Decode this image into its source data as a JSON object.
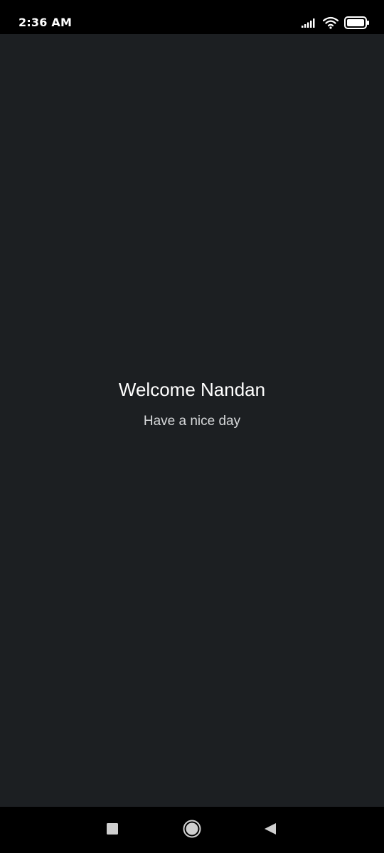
{
  "status_bar": {
    "time": "2:36 AM",
    "icons": [
      "signal-icon",
      "wifi-icon",
      "battery-icon"
    ]
  },
  "main": {
    "title": "Welcome Nandan",
    "subtitle": "Have a nice day"
  },
  "nav_bar": {
    "buttons": [
      "recents-icon",
      "home-icon",
      "back-icon"
    ]
  },
  "colors": {
    "background": "#1c1f22",
    "bars": "#000000",
    "title_text": "#ffffff",
    "subtitle_text": "#d6d8da",
    "nav_icons": "#cfcfcf"
  }
}
